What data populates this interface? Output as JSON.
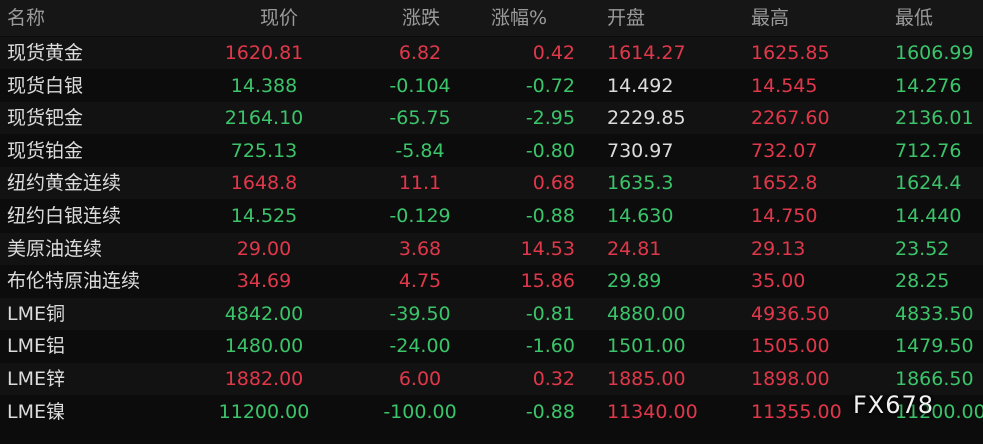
{
  "colors": {
    "up": "#e0384a",
    "down": "#3bc46a",
    "flat": "#dcdcdc",
    "header_text": "#9a9a9a",
    "background": "#0c0c0c"
  },
  "columns": [
    "名称",
    "现价",
    "涨跌",
    "涨幅%",
    "开盘",
    "最高",
    "最低"
  ],
  "rows": [
    {
      "name": "现货黄金",
      "price": "1620.81",
      "change": "6.82",
      "pct": "0.42",
      "open": "1614.27",
      "high": "1625.85",
      "low": "1606.99",
      "c": {
        "price": "up",
        "change": "up",
        "pct": "up",
        "open": "up",
        "high": "up",
        "low": "down"
      }
    },
    {
      "name": "现货白银",
      "price": "14.388",
      "change": "-0.104",
      "pct": "-0.72",
      "open": "14.492",
      "high": "14.545",
      "low": "14.276",
      "c": {
        "price": "down",
        "change": "down",
        "pct": "down",
        "open": "flat",
        "high": "up",
        "low": "down"
      }
    },
    {
      "name": "现货钯金",
      "price": "2164.10",
      "change": "-65.75",
      "pct": "-2.95",
      "open": "2229.85",
      "high": "2267.60",
      "low": "2136.01",
      "c": {
        "price": "down",
        "change": "down",
        "pct": "down",
        "open": "flat",
        "high": "up",
        "low": "down"
      }
    },
    {
      "name": "现货铂金",
      "price": "725.13",
      "change": "-5.84",
      "pct": "-0.80",
      "open": "730.97",
      "high": "732.07",
      "low": "712.76",
      "c": {
        "price": "down",
        "change": "down",
        "pct": "down",
        "open": "flat",
        "high": "up",
        "low": "down"
      }
    },
    {
      "name": "纽约黄金连续",
      "price": "1648.8",
      "change": "11.1",
      "pct": "0.68",
      "open": "1635.3",
      "high": "1652.8",
      "low": "1624.4",
      "c": {
        "price": "up",
        "change": "up",
        "pct": "up",
        "open": "down",
        "high": "up",
        "low": "down"
      }
    },
    {
      "name": "纽约白银连续",
      "price": "14.525",
      "change": "-0.129",
      "pct": "-0.88",
      "open": "14.630",
      "high": "14.750",
      "low": "14.440",
      "c": {
        "price": "down",
        "change": "down",
        "pct": "down",
        "open": "down",
        "high": "up",
        "low": "down"
      }
    },
    {
      "name": "美原油连续",
      "price": "29.00",
      "change": "3.68",
      "pct": "14.53",
      "open": "24.81",
      "high": "29.13",
      "low": "23.52",
      "c": {
        "price": "up",
        "change": "up",
        "pct": "up",
        "open": "up",
        "high": "up",
        "low": "down"
      }
    },
    {
      "name": "布伦特原油连续",
      "price": "34.69",
      "change": "4.75",
      "pct": "15.86",
      "open": "29.89",
      "high": "35.00",
      "low": "28.25",
      "c": {
        "price": "up",
        "change": "up",
        "pct": "up",
        "open": "down",
        "high": "up",
        "low": "down"
      }
    },
    {
      "name": "LME铜",
      "price": "4842.00",
      "change": "-39.50",
      "pct": "-0.81",
      "open": "4880.00",
      "high": "4936.50",
      "low": "4833.50",
      "c": {
        "price": "down",
        "change": "down",
        "pct": "down",
        "open": "down",
        "high": "up",
        "low": "down"
      }
    },
    {
      "name": "LME铝",
      "price": "1480.00",
      "change": "-24.00",
      "pct": "-1.60",
      "open": "1501.00",
      "high": "1505.00",
      "low": "1479.50",
      "c": {
        "price": "down",
        "change": "down",
        "pct": "down",
        "open": "down",
        "high": "up",
        "low": "down"
      }
    },
    {
      "name": "LME锌",
      "price": "1882.00",
      "change": "6.00",
      "pct": "0.32",
      "open": "1885.00",
      "high": "1898.00",
      "low": "1866.50",
      "c": {
        "price": "up",
        "change": "up",
        "pct": "up",
        "open": "up",
        "high": "up",
        "low": "down"
      }
    },
    {
      "name": "LME镍",
      "price": "11200.00",
      "change": "-100.00",
      "pct": "-0.88",
      "open": "11340.00",
      "high": "11355.00",
      "low": "11200.00",
      "c": {
        "price": "down",
        "change": "down",
        "pct": "down",
        "open": "up",
        "high": "up",
        "low": "down"
      }
    }
  ],
  "watermark": "FX678"
}
